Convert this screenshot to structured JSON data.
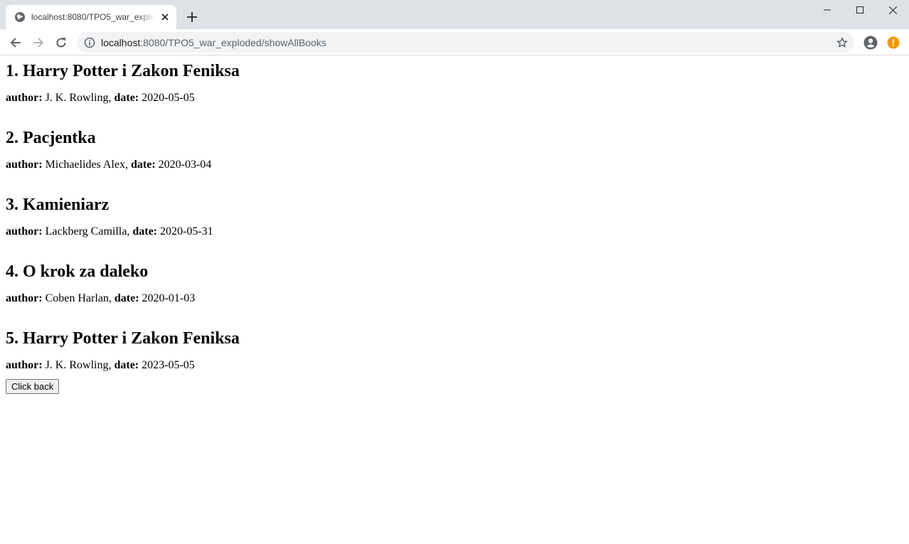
{
  "browser": {
    "tab_title": "localhost:8080/TPO5_war_exploded/showAllBooks",
    "url_host": "localhost",
    "url_rest": ":8080/TPO5_war_exploded/showAllBooks"
  },
  "icons": [
    "globe-icon",
    "close-icon",
    "plus-icon",
    "minimize-icon",
    "maximize-icon",
    "window-close-icon",
    "back-arrow-icon",
    "forward-arrow-icon",
    "reload-icon",
    "info-icon",
    "star-icon",
    "account-icon",
    "warning-icon"
  ],
  "books": [
    {
      "heading": "1. Harry Potter i Zakon Feniksa",
      "author_label": "author:",
      "author": " J. K. Rowling, ",
      "date_label": "date:",
      "date": " 2020-05-05"
    },
    {
      "heading": "2. Pacjentka",
      "author_label": "author:",
      "author": " Michaelides Alex, ",
      "date_label": "date:",
      "date": " 2020-03-04"
    },
    {
      "heading": "3. Kamieniarz",
      "author_label": "author:",
      "author": " Lackberg Camilla, ",
      "date_label": "date:",
      "date": " 2020-05-31"
    },
    {
      "heading": "4. O krok za daleko",
      "author_label": "author:",
      "author": " Coben Harlan, ",
      "date_label": "date:",
      "date": " 2020-01-03"
    },
    {
      "heading": "5. Harry Potter i Zakon Feniksa",
      "author_label": "author:",
      "author": " J. K. Rowling, ",
      "date_label": "date:",
      "date": " 2023-05-05"
    }
  ],
  "back_button": "Click back",
  "colors": {
    "chrome_bg": "#dee1e6",
    "omnibox_bg": "#f1f3f4",
    "warning": "#f29900"
  }
}
